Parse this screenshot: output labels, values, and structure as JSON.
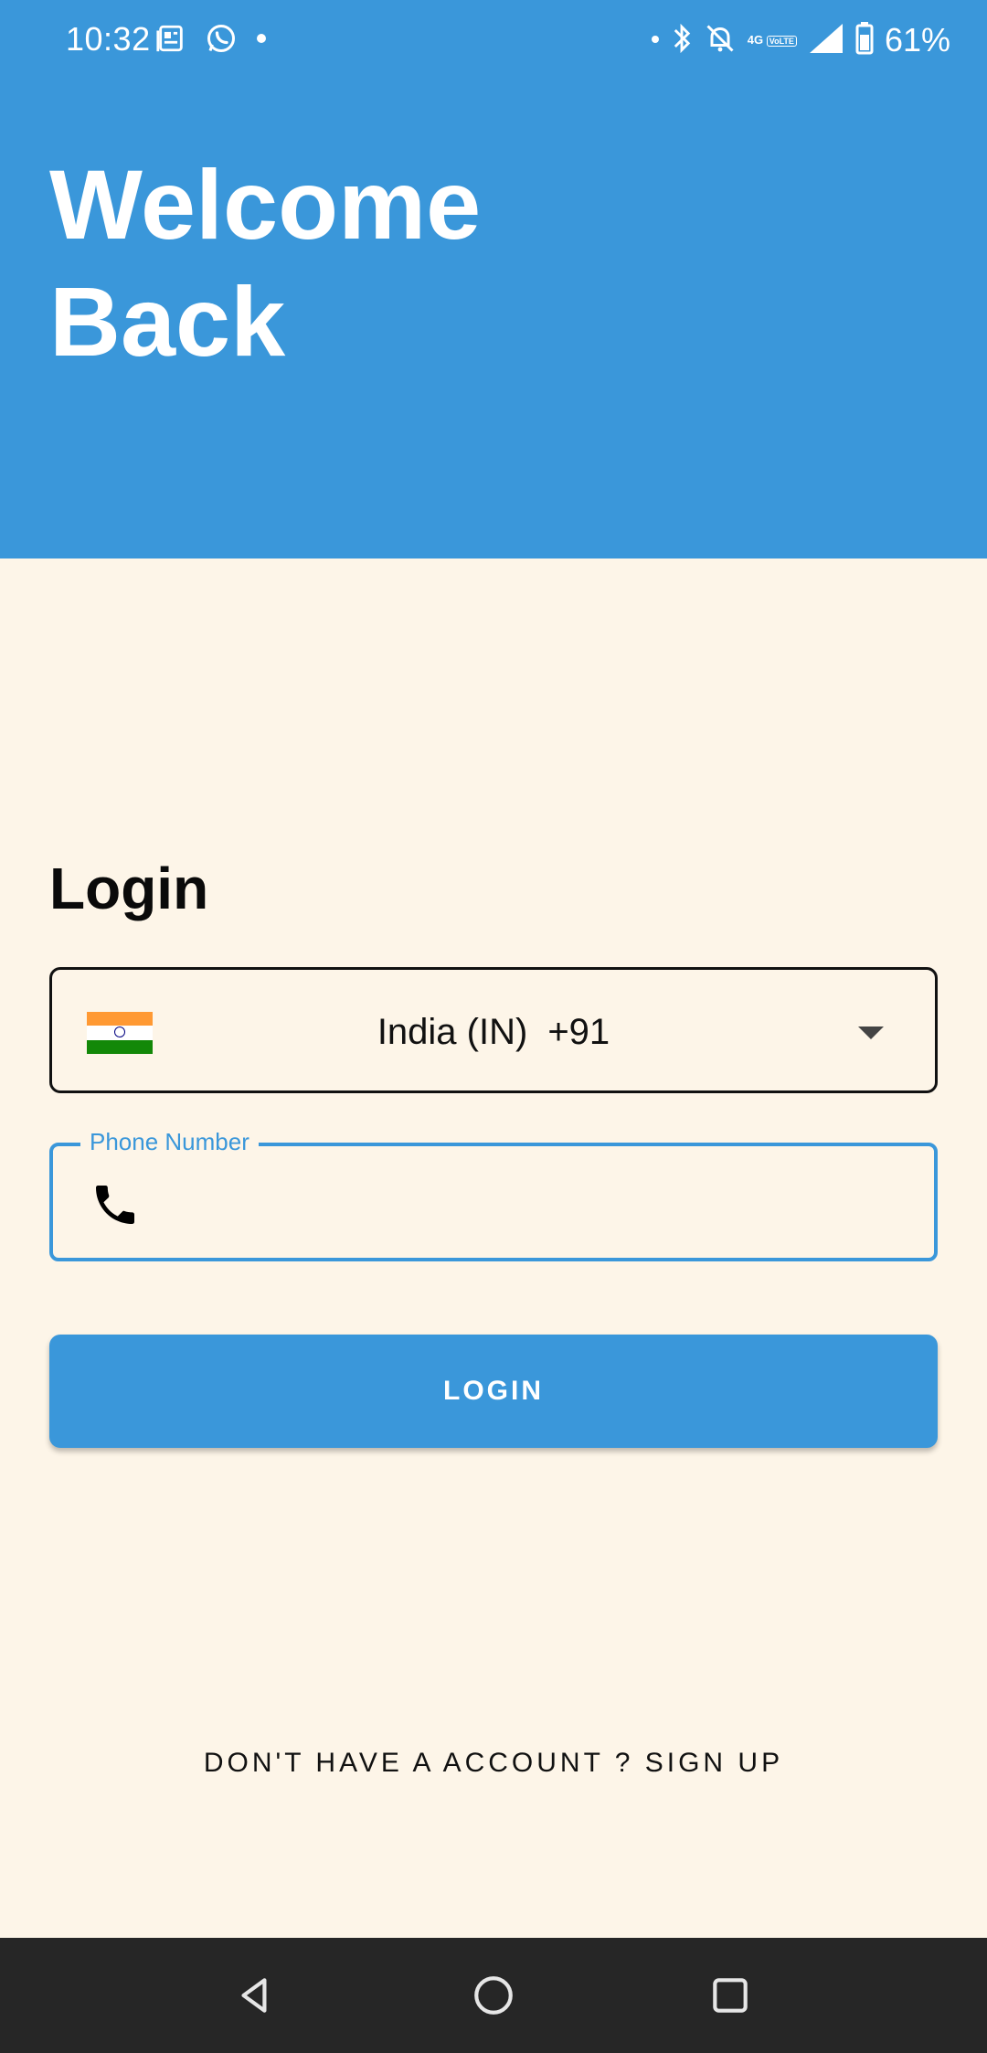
{
  "status_bar": {
    "time": "10:32",
    "network": "4G",
    "network_sub": "VoLTE",
    "battery": "61%",
    "left_icons": [
      "news-icon",
      "whatsapp-icon",
      "dot-icon"
    ],
    "right_icons": [
      "dot-icon",
      "bluetooth-icon",
      "bell-off-icon",
      "4g-volte-icon",
      "signal-icon",
      "battery-icon"
    ]
  },
  "header": {
    "title_line1": "Welcome",
    "title_line2": "Back",
    "background": "#3A97DA"
  },
  "login": {
    "title": "Login",
    "country": {
      "name": "India (IN)",
      "dial_code": "+91",
      "flag_icon": "india-flag-icon"
    },
    "phone": {
      "label": "Phone Number",
      "value": "",
      "icon": "phone-icon"
    },
    "button_label": "LOGIN",
    "signup_text": "DON'T HAVE A ACCOUNT ? SIGN UP"
  },
  "colors": {
    "accent": "#3A97DA",
    "page_background": "#FDF5E8",
    "nav_bar": "#262626"
  },
  "nav": {
    "buttons": [
      "back-icon",
      "home-icon",
      "recents-icon"
    ]
  }
}
